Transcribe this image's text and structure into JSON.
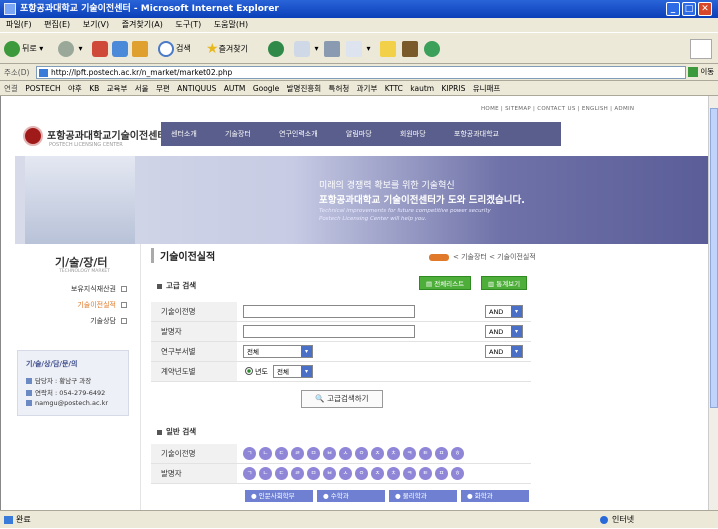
{
  "window": {
    "title": "포항공과대학교 기술이전센터 - Microsoft Internet Explorer"
  },
  "menu": [
    "파일(F)",
    "편집(E)",
    "보기(V)",
    "즐겨찾기(A)",
    "도구(T)",
    "도움말(H)"
  ],
  "toolbar": {
    "back_label": "뒤로",
    "search_label": "검색",
    "favorites_label": "즐겨찾기"
  },
  "address": {
    "label": "주소(D)",
    "url": "http://lpft.postech.ac.kr/n_market/market02.php",
    "go_label": "이동"
  },
  "links": {
    "label": "연결",
    "items": [
      "POSTECH",
      "야후",
      "KB",
      "교육부",
      "서울",
      "무편",
      "ANTIQUUS",
      "AUTM",
      "Google",
      "발명진흥회",
      "특허청",
      "과기부",
      "KTTC",
      "kautm",
      "KIPRIS",
      "유니패프"
    ]
  },
  "page": {
    "header_links": "HOME  |  SITEMAP  |  CONTACT US  |  ENGLISH  |  ADMIN",
    "logo_name": "포항공과대학교기술이전센터",
    "logo_sub": "POSTECH LICENSING CENTER",
    "nav": [
      "센터소개",
      "기술장터",
      "연구인력소개",
      "알림마당",
      "회원마당",
      "포항공과대학교"
    ],
    "banner": {
      "line1": "미래의 경쟁력 확보를 위한 기술혁신",
      "line2": "포항공과대학교 기술이전센터가 도와 드리겠습니다.",
      "line3": "Technical improvements for future competitive power security",
      "line4": "Postech Licensing Center will help you."
    },
    "sidebar": {
      "title": "기/술/장/터",
      "subtitle": "TECHNOLOGY MARKET",
      "items": [
        "보유지식재산권",
        "기술이전실적",
        "기술상담"
      ],
      "contact_title": "기/술/상/담/문/의",
      "contact_lines": [
        "담당자 : 황남구 과장",
        "연락처 : 054-279-6492",
        "namgu@postech.ac.kr"
      ]
    },
    "title": "기술이전실적",
    "breadcrumb": "< 기술장터 < 기술이전실적",
    "advanced": {
      "title": "고급 검색",
      "btn_list": "전체리스트",
      "btn_stats": "통계보기",
      "fields": [
        {
          "label": "기술이전명",
          "op": "AND"
        },
        {
          "label": "발명자",
          "op": "AND"
        },
        {
          "label": "연구부서별",
          "select": "전체",
          "op": "AND"
        },
        {
          "label": "계약년도별",
          "radio": "년도",
          "select": "전체"
        }
      ],
      "search_button": "고급검색하기"
    },
    "general": {
      "title": "일반 검색",
      "rows": [
        {
          "label": "기술이전명",
          "letters": [
            "ㄱ",
            "ㄴ",
            "ㄷ",
            "ㄹ",
            "ㅁ",
            "ㅂ",
            "ㅅ",
            "ㅇ",
            "ㅈ",
            "ㅊ",
            "ㅋ",
            "ㅌ",
            "ㅍ",
            "ㅎ"
          ]
        },
        {
          "label": "발명자",
          "letters": [
            "ㄱ",
            "ㄴ",
            "ㄷ",
            "ㄹ",
            "ㅁ",
            "ㅂ",
            "ㅅ",
            "ㅇ",
            "ㅈ",
            "ㅊ",
            "ㅋ",
            "ㅌ",
            "ㅍ",
            "ㅎ"
          ]
        }
      ],
      "departments": [
        "인문사회학부",
        "수학과",
        "물리학과",
        "화학과"
      ]
    }
  },
  "status": {
    "left": "완료",
    "right": "인터넷"
  },
  "colors": {
    "xp_title": "#0a3fb8",
    "nav_bg": "#5a5e8c",
    "green_button": "#4eae3a",
    "bubble": "#8f86d8",
    "dept_tab": "#6f80d3"
  }
}
